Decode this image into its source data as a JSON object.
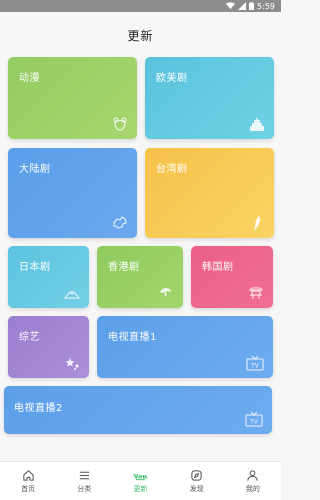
{
  "status_bar": {
    "time": "5:59"
  },
  "header": {
    "title": "更新"
  },
  "cards": {
    "anime": "动漫",
    "western": "欧美剧",
    "mainland": "大陆剧",
    "taiwan": "台湾剧",
    "japan": "日本剧",
    "hongkong": "香港剧",
    "korea": "韩国剧",
    "variety": "综艺",
    "tv1": "电视直播1",
    "tv2": "电视直播2"
  },
  "tabs": [
    {
      "label": "首页",
      "icon": "home-icon",
      "active": false
    },
    {
      "label": "分类",
      "icon": "list-icon",
      "active": false
    },
    {
      "label": "更新",
      "icon": "new-badge-icon",
      "active": true
    },
    {
      "label": "发现",
      "icon": "discover-icon",
      "active": false
    },
    {
      "label": "我的",
      "icon": "user-icon",
      "active": false
    }
  ],
  "colors": {
    "accent": "#3cc06a",
    "anime": "#93cd63",
    "western": "#5bc2de",
    "mainland": "#5b9ee9",
    "taiwan": "#f6c24a",
    "korea": "#ec5f86",
    "variety": "#9b7fcf"
  }
}
